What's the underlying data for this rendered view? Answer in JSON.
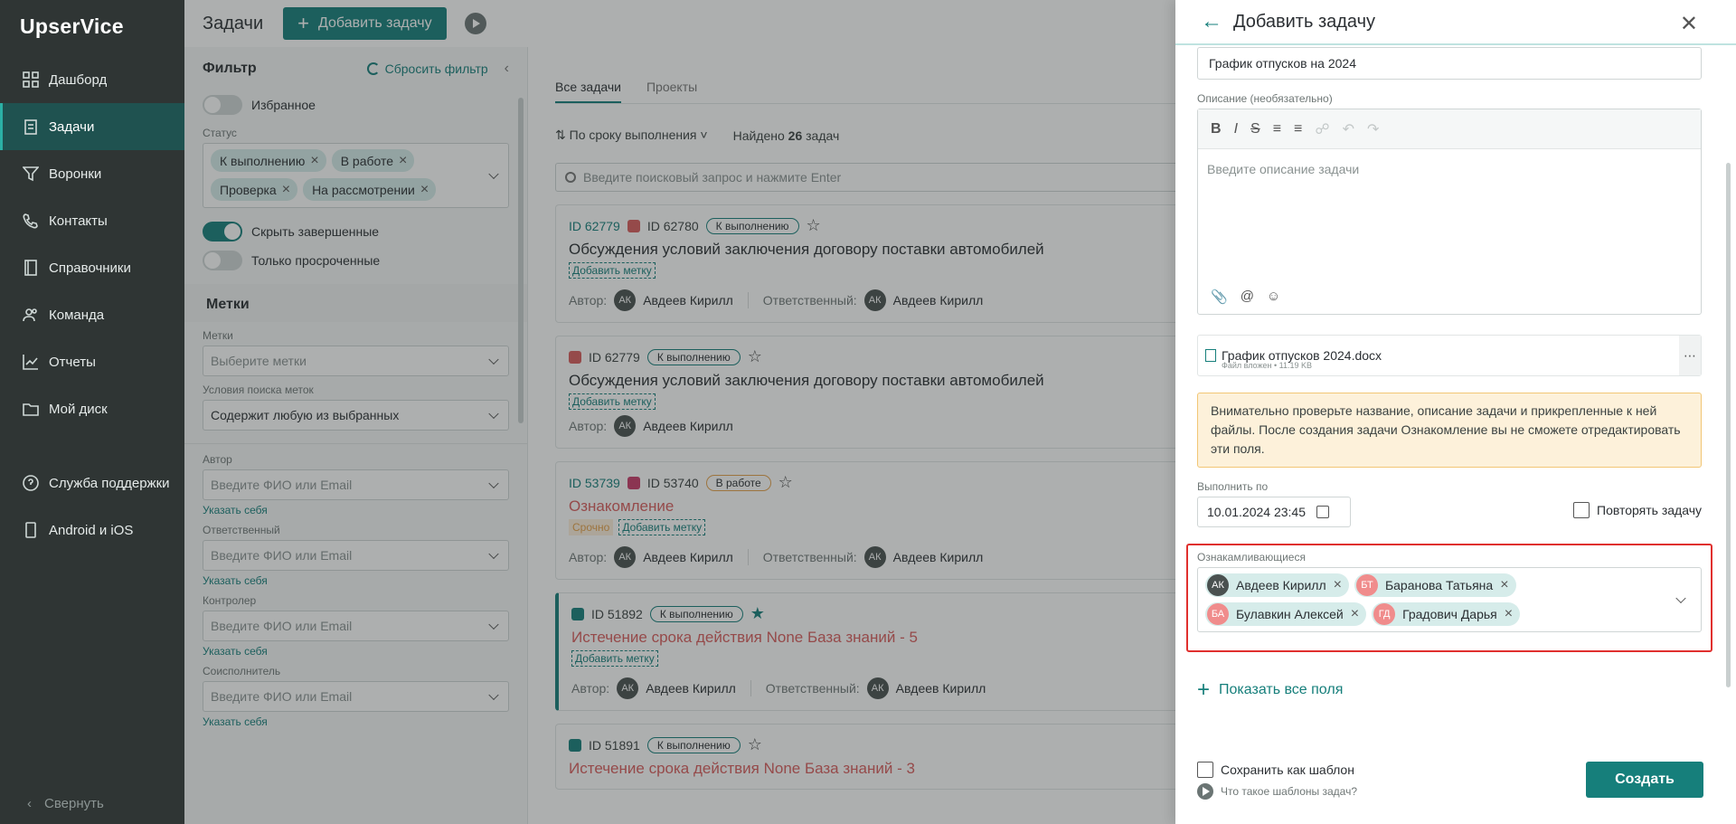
{
  "app": {
    "logo": "UpserVice"
  },
  "sidebar": {
    "items": [
      {
        "label": "Дашборд",
        "icon": "dashboard-icon",
        "active": false
      },
      {
        "label": "Задачи",
        "icon": "tasks-icon",
        "active": true
      },
      {
        "label": "Воронки",
        "icon": "funnel-icon",
        "active": false
      },
      {
        "label": "Контакты",
        "icon": "phone-icon",
        "active": false
      },
      {
        "label": "Справочники",
        "icon": "book-icon",
        "active": false
      },
      {
        "label": "Команда",
        "icon": "team-icon",
        "active": false
      },
      {
        "label": "Отчеты",
        "icon": "chart-icon",
        "active": false
      },
      {
        "label": "Мой диск",
        "icon": "folder-icon",
        "active": false
      }
    ],
    "bottom_items": [
      {
        "label": "Служба поддержки",
        "icon": "help-icon"
      },
      {
        "label": "Android и iOS",
        "icon": "mobile-icon"
      }
    ],
    "collapse": "Свернуть"
  },
  "header": {
    "title": "Задачи",
    "add_task": "Добавить задачу"
  },
  "filter": {
    "title": "Фильтр",
    "reset": "Сбросить фильтр",
    "favorites": "Избранное",
    "status_label": "Статус",
    "statuses": [
      "К выполнению",
      "В работе",
      "Проверка",
      "На рассмотрении"
    ],
    "hide_done": "Скрыть завершенные",
    "only_overdue": "Только просроченные",
    "tags_section": "Метки",
    "tags_label": "Метки",
    "tags_placeholder": "Выберите метки",
    "tag_search_label": "Условия поиска меток",
    "tag_search_value": "Содержит любую из выбранных",
    "author_label": "Автор",
    "responsible_label": "Ответственный",
    "controller_label": "Контролер",
    "coexecutor_label": "Соисполнитель",
    "person_placeholder": "Введите ФИО или Email",
    "assign_self": "Указать себя"
  },
  "list": {
    "tabs": [
      "Все задачи",
      "Проекты"
    ],
    "sort": "По сроку выполнения",
    "found_prefix": "Найдено",
    "found_count": "26",
    "found_suffix": "задач",
    "search_placeholder": "Введите поисковый запрос и нажмите Enter",
    "add_tag": "Добавить метку",
    "author_prefix": "Автор:",
    "responsible_prefix": "Ответственный:",
    "cards": [
      {
        "id1": "ID 62779",
        "id2": "ID 62780",
        "status": "К выполнению",
        "title": "Обсуждения условий заключения договору поставки автомобилей",
        "author": "Авдеев Кирилл",
        "responsible": "Авдеев Кирилл",
        "avatar": "АК"
      },
      {
        "id2": "ID 62779",
        "status": "К выполнению",
        "title": "Обсуждения условий заключения договору поставки автомобилей",
        "author": "Авдеев Кирилл",
        "avatar": "АК"
      },
      {
        "id1": "ID 53739",
        "id2": "ID 53740",
        "status": "В работе",
        "title": "Ознакомление",
        "urgent": "Срочно",
        "author": "Авдеев Кирилл",
        "responsible": "Авдеев Кирилл",
        "avatar": "АК"
      },
      {
        "id2": "ID 51892",
        "status": "К выполнению",
        "title": "Истечение срока действия None База знаний - 5",
        "author": "Авдеев Кирилл",
        "responsible": "Авдеев Кирилл",
        "avatar": "АК"
      },
      {
        "id2": "ID 51891",
        "status": "К выполнению",
        "title": "Истечение срока действия None База знаний - 3"
      }
    ]
  },
  "modal": {
    "title": "Добавить задачу",
    "name_value": "График отпусков на 2024",
    "description_label": "Описание (необязательно)",
    "description_placeholder": "Введите описание задачи",
    "attachment_name": "График отпусков 2024.docx",
    "attachment_meta": "Файл вложен • 11.19 KB",
    "warning": "Внимательно проверьте название, описание задачи и прикрепленные к ней файлы. После создания задачи Ознакомление вы не сможете отредактировать эти поля.",
    "due_label": "Выполнить по",
    "due_value": "10.01.2024 23:45",
    "repeat": "Повторять задачу",
    "recipients_label": "Ознакамливающиеся",
    "recipients": [
      {
        "initials": "АК",
        "name": "Авдеев Кирилл",
        "color": "#4a5150"
      },
      {
        "initials": "БТ",
        "name": "Баранова Татьяна",
        "color": "#f08c8c"
      },
      {
        "initials": "БА",
        "name": "Булавкин Алексей",
        "color": "#f08c8c"
      },
      {
        "initials": "ГД",
        "name": "Градович Дарья",
        "color": "#f08c8c"
      }
    ],
    "show_all": "Показать все поля",
    "save_template": "Сохранить как шаблон",
    "what_template": "Что такое шаблоны задач?",
    "create": "Создать"
  },
  "colors": {
    "accent": "#167f7b",
    "sidebar": "#2f3534",
    "warning_bg": "#fdf1da",
    "highlight": "#e0302e"
  }
}
